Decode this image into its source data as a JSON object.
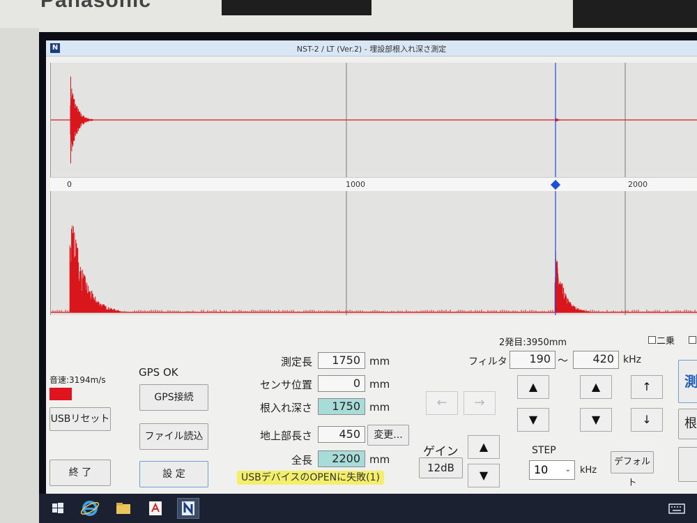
{
  "device": {
    "brand": "Panasonic"
  },
  "window": {
    "title": "NST-2 / LT (Ver.2) - 埋設部根入れ深さ測定",
    "icon_letter": "N"
  },
  "chart_data": [
    {
      "type": "line",
      "name": "time-waveform",
      "x_range": [
        0,
        2200
      ],
      "y_range": [
        -1,
        1
      ],
      "grid_x": [
        1000,
        2000
      ],
      "cursor_x": 1750,
      "series_color": "#d9161b",
      "bursts": [
        {
          "x": 10,
          "amplitude": 0.95,
          "decay": 20
        },
        {
          "x": 1750,
          "amplitude": 0.05,
          "decay": 10
        }
      ]
    },
    {
      "type": "line",
      "name": "envelope",
      "x_range": [
        0,
        2200
      ],
      "y_range": [
        0,
        1
      ],
      "grid_x": [
        1000,
        2000
      ],
      "cursor_x": 1750,
      "series_color": "#d9161b",
      "bursts": [
        {
          "x": 10,
          "amplitude": 1.0,
          "decay": 45
        },
        {
          "x": 1750,
          "amplitude": 0.55,
          "decay": 30
        }
      ]
    }
  ],
  "axis": {
    "ticks": [
      "0",
      "1000",
      "2000"
    ]
  },
  "status": {
    "speed_label": "音速:3194m/s",
    "gps_status": "GPS OK",
    "second_arrival": "2発目:3950mm",
    "usb_error": "USBデバイスのOPENに失敗(1)"
  },
  "buttons": {
    "usb_reset": "USBリセット",
    "gps_connect": "GPS接続",
    "file_read": "ファイル読込",
    "settings": "設 定",
    "exit": "終 了",
    "change": "変更...",
    "default": "デフォルト"
  },
  "fields": {
    "measure_length": {
      "label": "測定長",
      "value": "1750",
      "unit": "mm"
    },
    "sensor_position": {
      "label": "センサ位置",
      "value": "0",
      "unit": "mm"
    },
    "embed_depth": {
      "label": "根入れ深さ",
      "value": "1750",
      "unit": "mm"
    },
    "above_ground": {
      "label": "地上部長さ",
      "value": "450"
    },
    "total_length": {
      "label": "全長",
      "value": "2200",
      "unit": "mm"
    }
  },
  "gain": {
    "label": "ゲイン",
    "value": "12dB"
  },
  "filter": {
    "label": "フィルタ",
    "low": "190",
    "sep": "～",
    "high": "420",
    "unit": "kHz"
  },
  "step": {
    "label": "STEP",
    "value": "10",
    "unit": "kHz"
  },
  "options": {
    "square": "二乗"
  },
  "arrows": {
    "up": "▲",
    "down": "▼",
    "left": "←",
    "right": "→",
    "up_thin": "↑",
    "down_thin": "↓"
  },
  "right_buttons": {
    "measure_partial": "測",
    "root_partial": "根"
  }
}
